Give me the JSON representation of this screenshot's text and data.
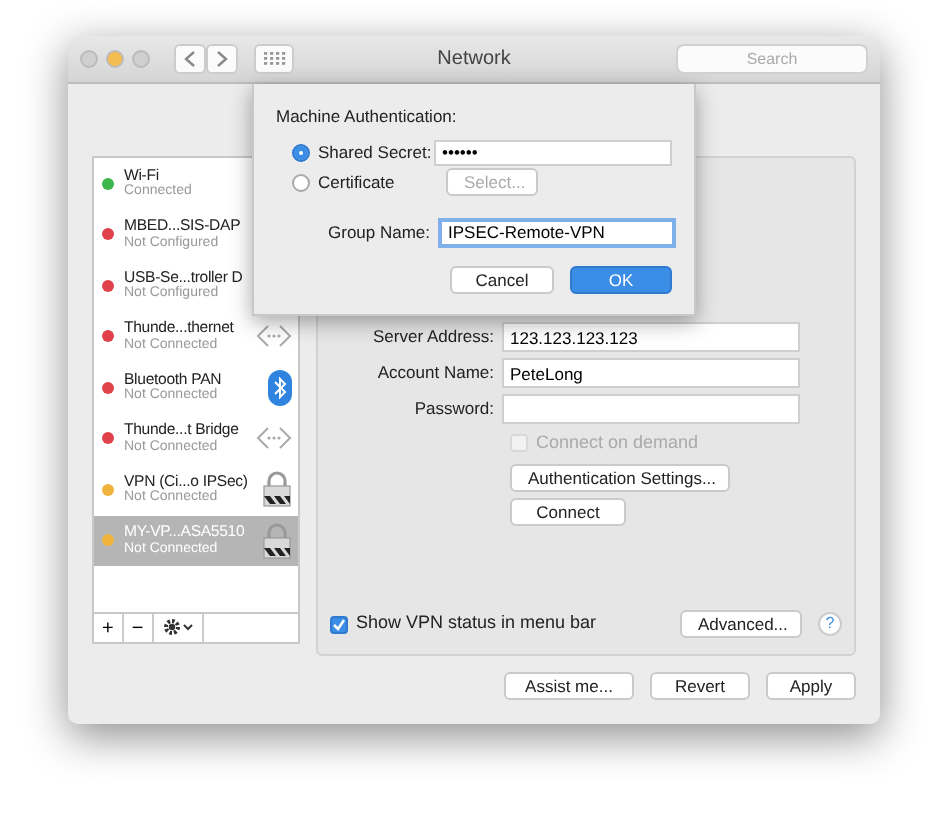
{
  "window": {
    "title": "Network",
    "search": {
      "placeholder": "Search"
    }
  },
  "sidebar": {
    "items": [
      {
        "name": "Wi-Fi",
        "status": "Connected",
        "color": "#3cb54a",
        "selected": false
      },
      {
        "name": "MBED...SIS-DAP",
        "status": "Not Configured",
        "color": "#e0424b",
        "selected": false
      },
      {
        "name": "USB-Se...troller D",
        "status": "Not Configured",
        "color": "#e0424b",
        "selected": false
      },
      {
        "name": "Thunde...thernet",
        "status": "Not Connected",
        "color": "#e0424b",
        "selected": false,
        "kind": "ethernet"
      },
      {
        "name": "Bluetooth PAN",
        "status": "Not Connected",
        "color": "#e0424b",
        "selected": false,
        "kind": "bluetooth"
      },
      {
        "name": "Thunde...t Bridge",
        "status": "Not Connected",
        "color": "#e0424b",
        "selected": false,
        "kind": "ethernet"
      },
      {
        "name": "VPN (Ci...o IPSec)",
        "status": "Not Connected",
        "color": "#f0b43c",
        "selected": false,
        "kind": "vpn"
      },
      {
        "name": "MY-VP...ASA5510",
        "status": "Not Connected",
        "color": "#f0b43c",
        "selected": true,
        "kind": "vpn"
      }
    ],
    "toolbar": [
      "+",
      "−"
    ]
  },
  "form": {
    "fields": [
      {
        "label": "Server Address:",
        "value": "123.123.123.123"
      },
      {
        "label": "Account Name:",
        "value": "PeteLong"
      },
      {
        "label": "Password:"
      }
    ],
    "connect_on_demand": {
      "label": "Connect on demand",
      "checked": false,
      "disabled": true
    },
    "buttons": [
      "Authentication Settings...",
      "Connect"
    ],
    "show_status": {
      "label": "Show VPN status in menu bar",
      "checked": true
    },
    "advanced": "Advanced...",
    "help": "?"
  },
  "footer_buttons": [
    "Assist me...",
    "Revert",
    "Apply"
  ],
  "sheet": {
    "heading": "Machine Authentication:",
    "options": [
      {
        "label": "Shared Secret:",
        "selected": true,
        "value": "••••••"
      },
      {
        "label": "Certificate",
        "selected": false,
        "button": "Select...",
        "button_disabled": true
      }
    ],
    "group_label": "Group Name:",
    "group_value": "IPSEC-Remote-VPN",
    "cancel": "Cancel",
    "ok": "OK"
  }
}
